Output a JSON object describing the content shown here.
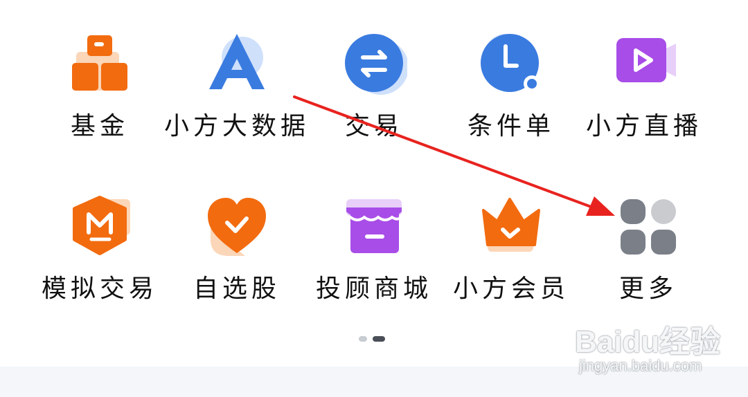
{
  "tiles": [
    {
      "label": "基金",
      "icon": "gold-bars-icon"
    },
    {
      "label": "小方大数据",
      "icon": "big-data-triangle-icon"
    },
    {
      "label": "交易",
      "icon": "swap-arrows-icon"
    },
    {
      "label": "条件单",
      "icon": "clock-icon"
    },
    {
      "label": "小方直播",
      "icon": "video-play-icon"
    },
    {
      "label": "模拟交易",
      "icon": "m-hexagon-icon"
    },
    {
      "label": "自选股",
      "icon": "heart-check-icon"
    },
    {
      "label": "投顾商城",
      "icon": "shop-awning-icon"
    },
    {
      "label": "小方会员",
      "icon": "crown-icon"
    },
    {
      "label": "更多",
      "icon": "more-grid-icon"
    }
  ],
  "pagination": {
    "pages": 2,
    "active_page": 2
  },
  "watermark": {
    "brand": "Baidu经验",
    "url": "jingyan.baidu.com"
  },
  "colors": {
    "orange": "#f26b0f",
    "orange_light": "#fbd6b8",
    "blue": "#3a7be0",
    "blue_light": "#cfe0fb",
    "purple": "#a84de8",
    "purple_light": "#e7cff9",
    "gray": "#7a7f88",
    "gray_light": "#c9cbcf",
    "arrow_red": "#e8231f"
  }
}
